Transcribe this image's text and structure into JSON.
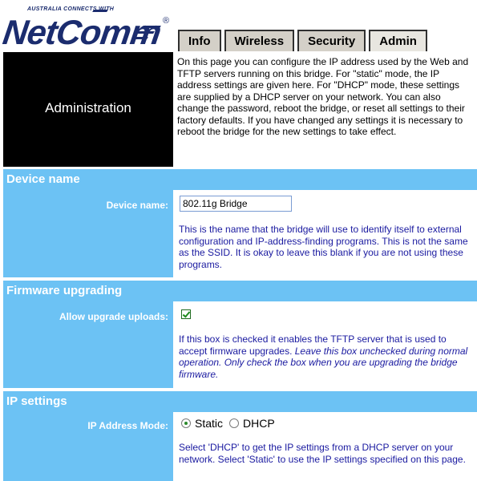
{
  "logo": {
    "tagline": "AUSTRALIA CONNECTS WITH",
    "brand": "NetComm",
    "registered": "®"
  },
  "tabs": [
    {
      "label": "Info"
    },
    {
      "label": "Wireless"
    },
    {
      "label": "Security"
    },
    {
      "label": "Admin"
    }
  ],
  "admin": {
    "title": "Administration",
    "description": "On this page you can configure the IP address used by the Web and TFTP servers running on this bridge. For \"static\" mode, the IP address settings are given here. For \"DHCP\" mode, these settings are supplied by a DHCP server on your network. You can also change the password, reboot the bridge, or reset all settings to their factory defaults. If you have changed any settings it is necessary to reboot the bridge for the new settings to take effect."
  },
  "device_name": {
    "section_title": "Device name",
    "label": "Device name:",
    "value": "802.11g Bridge",
    "description": "This is the name that the bridge will use to identify itself to external configuration and IP-address-finding programs. This is not the same as the SSID. It is okay to leave this blank if you are not using these programs."
  },
  "firmware": {
    "section_title": "Firmware upgrading",
    "label": "Allow upgrade uploads:",
    "checked": true,
    "description_normal": "If this box is checked it enables the TFTP server that is used to accept firmware upgrades.",
    "description_italic": "Leave this box unchecked during normal operation. Only check the box when you are upgrading the bridge firmware."
  },
  "ip_settings": {
    "section_title": "IP settings",
    "label": "IP Address Mode:",
    "options": [
      {
        "label": "Static",
        "selected": true
      },
      {
        "label": "DHCP",
        "selected": false
      }
    ],
    "description": "Select 'DHCP' to get the IP settings from a DHCP server on your network. Select 'Static' to use the IP settings specified on this page."
  },
  "colors": {
    "section_blue": "#6cc2f4",
    "brand_navy": "#1b2c6e",
    "help_text": "#1a1aa0"
  }
}
